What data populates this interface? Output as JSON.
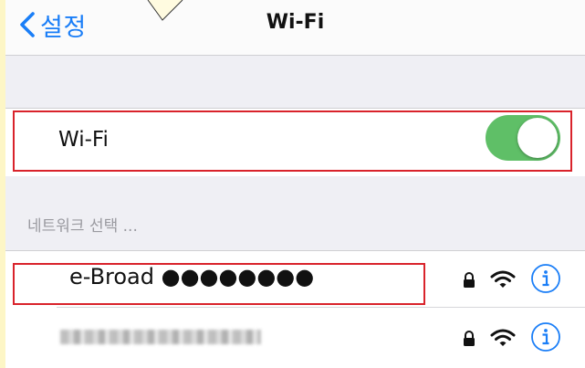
{
  "navbar": {
    "back_label": "설정",
    "title": "Wi-Fi"
  },
  "wifi_toggle": {
    "label": "Wi-Fi",
    "state": "on",
    "on_color": "#5fbf67"
  },
  "network_section": {
    "header": "네트워크 선택 ..."
  },
  "networks": [
    {
      "name": "e-Broad ●●●●●●●●",
      "secured": true,
      "icons": [
        "lock-icon",
        "wifi-signal-icon",
        "info-icon"
      ]
    },
    {
      "name": "",
      "obscured": true,
      "secured": true,
      "icons": [
        "lock-icon",
        "wifi-signal-icon",
        "info-icon"
      ]
    }
  ],
  "colors": {
    "accent": "#1a7ef7",
    "highlight": "#d9232b",
    "background": "#efeff4"
  }
}
